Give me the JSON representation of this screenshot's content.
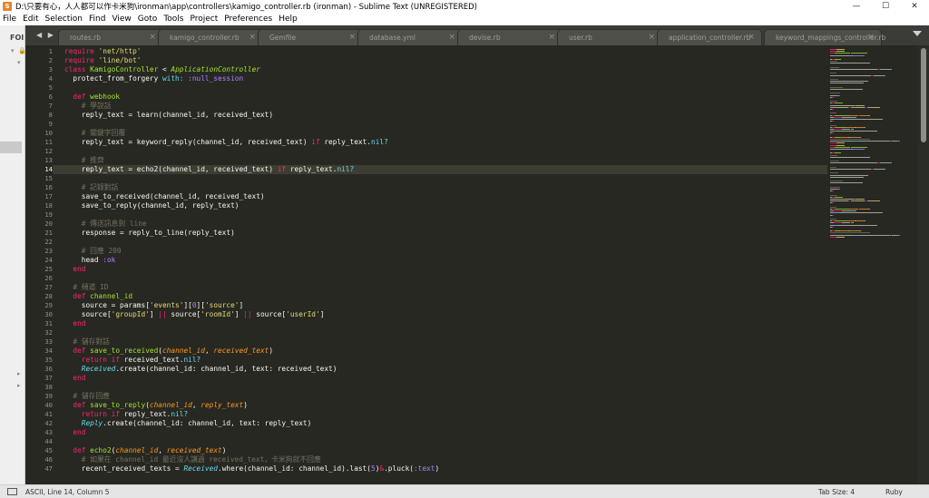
{
  "window": {
    "title": "D:\\只要有心，人人都可以作卡米狗\\ironman\\app\\controllers\\kamigo_controller.rb (ironman) - Sublime Text (UNREGISTERED)",
    "icon_letter": "S",
    "min": "—",
    "max": "☐",
    "close": "✕"
  },
  "menu": [
    "File",
    "Edit",
    "Selection",
    "Find",
    "View",
    "Goto",
    "Tools",
    "Project",
    "Preferences",
    "Help"
  ],
  "sidebar": {
    "title": "FOI"
  },
  "tabs": {
    "nav": "◀ ▶",
    "close_glyph": "×",
    "items": [
      {
        "label": "routes.rb",
        "active": false
      },
      {
        "label": "kamigo_controller.rb",
        "active": true
      },
      {
        "label": "Gemfile",
        "active": false
      },
      {
        "label": "database.yml",
        "active": false
      },
      {
        "label": "devise.rb",
        "active": false
      },
      {
        "label": "user.rb",
        "active": false
      },
      {
        "label": "application_controller.rb",
        "active": false
      },
      {
        "label": "keyword_mappings_controller.rb",
        "active": false
      }
    ]
  },
  "editor": {
    "current_line": 14,
    "line_numbers": [
      "1",
      "2",
      "3",
      "4",
      "5",
      "6",
      "7",
      "8",
      "9",
      "10",
      "11",
      "12",
      "13",
      "14",
      "15",
      "16",
      "17",
      "18",
      "19",
      "20",
      "21",
      "22",
      "23",
      "24",
      "25",
      "26",
      "27",
      "28",
      "29",
      "30",
      "31",
      "32",
      "33",
      "34",
      "35",
      "36",
      "37",
      "38",
      "39",
      "40",
      "41",
      "42",
      "43",
      "44",
      "45",
      "46",
      "47"
    ],
    "lines": [
      [
        [
          "k",
          "require "
        ],
        [
          "s",
          "'net/http'"
        ]
      ],
      [
        [
          "k",
          "require "
        ],
        [
          "s",
          "'line/bot'"
        ]
      ],
      [
        [
          "k",
          "class "
        ],
        [
          "d",
          "KamigoController "
        ],
        [
          "x",
          "< "
        ],
        [
          "ih",
          "ApplicationController"
        ]
      ],
      [
        [
          "x",
          "  protect_from_forgery "
        ],
        [
          "y",
          "with: "
        ],
        [
          "n",
          ":null_session"
        ]
      ],
      [],
      [
        [
          "x",
          "  "
        ],
        [
          "k",
          "def "
        ],
        [
          "d",
          "webhook"
        ]
      ],
      [
        [
          "c",
          "    # 學說話"
        ]
      ],
      [
        [
          "x",
          "    reply_text = learn(channel_id, received_text)"
        ]
      ],
      [],
      [
        [
          "c",
          "    # 關鍵字回覆"
        ]
      ],
      [
        [
          "x",
          "    reply_text = keyword_reply(channel_id, received_text) "
        ],
        [
          "k",
          "if "
        ],
        [
          "x",
          "reply_text."
        ],
        [
          "y",
          "nil?"
        ]
      ],
      [],
      [
        [
          "c",
          "    # 推齊"
        ]
      ],
      [
        [
          "x",
          "    reply_text = echo2(channel_id, received_text) "
        ],
        [
          "k",
          "if "
        ],
        [
          "x",
          "reply_text."
        ],
        [
          "y",
          "nil?"
        ]
      ],
      [],
      [
        [
          "c",
          "    # 記錄對話"
        ]
      ],
      [
        [
          "x",
          "    save_to_received(channel_id, received_text)"
        ]
      ],
      [
        [
          "x",
          "    save_to_reply(channel_id, reply_text)"
        ]
      ],
      [],
      [
        [
          "c",
          "    # 傳送訊息到 line"
        ]
      ],
      [
        [
          "x",
          "    response = reply_to_line(reply_text)"
        ]
      ],
      [],
      [
        [
          "c",
          "    # 回應 200"
        ]
      ],
      [
        [
          "x",
          "    head "
        ],
        [
          "n",
          ":ok"
        ]
      ],
      [
        [
          "x",
          "  "
        ],
        [
          "k",
          "end"
        ]
      ],
      [],
      [
        [
          "c",
          "  # 頻道 ID"
        ]
      ],
      [
        [
          "x",
          "  "
        ],
        [
          "k",
          "def "
        ],
        [
          "d",
          "channel_id"
        ]
      ],
      [
        [
          "x",
          "    source = params["
        ],
        [
          "s",
          "'events'"
        ],
        [
          "x",
          "]["
        ],
        [
          "n",
          "0"
        ],
        [
          "x",
          "]["
        ],
        [
          "s",
          "'source'"
        ],
        [
          "x",
          "]"
        ]
      ],
      [
        [
          "x",
          "    source["
        ],
        [
          "s",
          "'groupId'"
        ],
        [
          "x",
          "] "
        ],
        [
          "k",
          "|| "
        ],
        [
          "x",
          "source["
        ],
        [
          "s",
          "'roomId'"
        ],
        [
          "x",
          "] "
        ],
        [
          "k",
          "|| "
        ],
        [
          "x",
          "source["
        ],
        [
          "s",
          "'userId'"
        ],
        [
          "x",
          "]"
        ]
      ],
      [
        [
          "x",
          "  "
        ],
        [
          "k",
          "end"
        ]
      ],
      [],
      [
        [
          "c",
          "  # 儲存對話"
        ]
      ],
      [
        [
          "x",
          "  "
        ],
        [
          "k",
          "def "
        ],
        [
          "d",
          "save_to_received"
        ],
        [
          "x",
          "("
        ],
        [
          "p",
          "channel_id"
        ],
        [
          "x",
          ", "
        ],
        [
          "p",
          "received_text"
        ],
        [
          "x",
          ")"
        ]
      ],
      [
        [
          "x",
          "    "
        ],
        [
          "k",
          "return if "
        ],
        [
          "x",
          "received_text."
        ],
        [
          "y",
          "nil?"
        ]
      ],
      [
        [
          "x",
          "    "
        ],
        [
          "cl",
          "Received"
        ],
        [
          "x",
          "."
        ],
        [
          "x",
          "create(channel_id: channel_id, text: received_text)"
        ]
      ],
      [
        [
          "x",
          "  "
        ],
        [
          "k",
          "end"
        ]
      ],
      [],
      [
        [
          "c",
          "  # 儲存回應"
        ]
      ],
      [
        [
          "x",
          "  "
        ],
        [
          "k",
          "def "
        ],
        [
          "d",
          "save_to_reply"
        ],
        [
          "x",
          "("
        ],
        [
          "p",
          "channel_id"
        ],
        [
          "x",
          ", "
        ],
        [
          "p",
          "reply_text"
        ],
        [
          "x",
          ")"
        ]
      ],
      [
        [
          "x",
          "    "
        ],
        [
          "k",
          "return if "
        ],
        [
          "x",
          "reply_text."
        ],
        [
          "y",
          "nil?"
        ]
      ],
      [
        [
          "x",
          "    "
        ],
        [
          "cl",
          "Reply"
        ],
        [
          "x",
          "."
        ],
        [
          "x",
          "create(channel_id: channel_id, text: reply_text)"
        ]
      ],
      [
        [
          "x",
          "  "
        ],
        [
          "k",
          "end"
        ]
      ],
      [],
      [
        [
          "x",
          "  "
        ],
        [
          "k",
          "def "
        ],
        [
          "d",
          "echo2"
        ],
        [
          "x",
          "("
        ],
        [
          "p",
          "channel_id"
        ],
        [
          "x",
          ", "
        ],
        [
          "p",
          "received_text"
        ],
        [
          "x",
          ")"
        ]
      ],
      [
        [
          "c",
          "    # 如果在 channel_id 最近沒人講過 received_text，卡米狗就不回應"
        ]
      ],
      [
        [
          "x",
          "    recent_received_texts = "
        ],
        [
          "cl",
          "Received"
        ],
        [
          "x",
          ".where(channel_id: channel_id).last("
        ],
        [
          "n",
          "5"
        ],
        [
          "x",
          ")"
        ],
        [
          "k",
          "&"
        ],
        [
          "x",
          ".pluck("
        ],
        [
          "n",
          ":text"
        ],
        [
          "x",
          ")"
        ]
      ]
    ]
  },
  "status": {
    "left": "ASCII, Line 14, Column 5",
    "tab_size": "Tab Size: 4",
    "syntax": "Ruby"
  }
}
